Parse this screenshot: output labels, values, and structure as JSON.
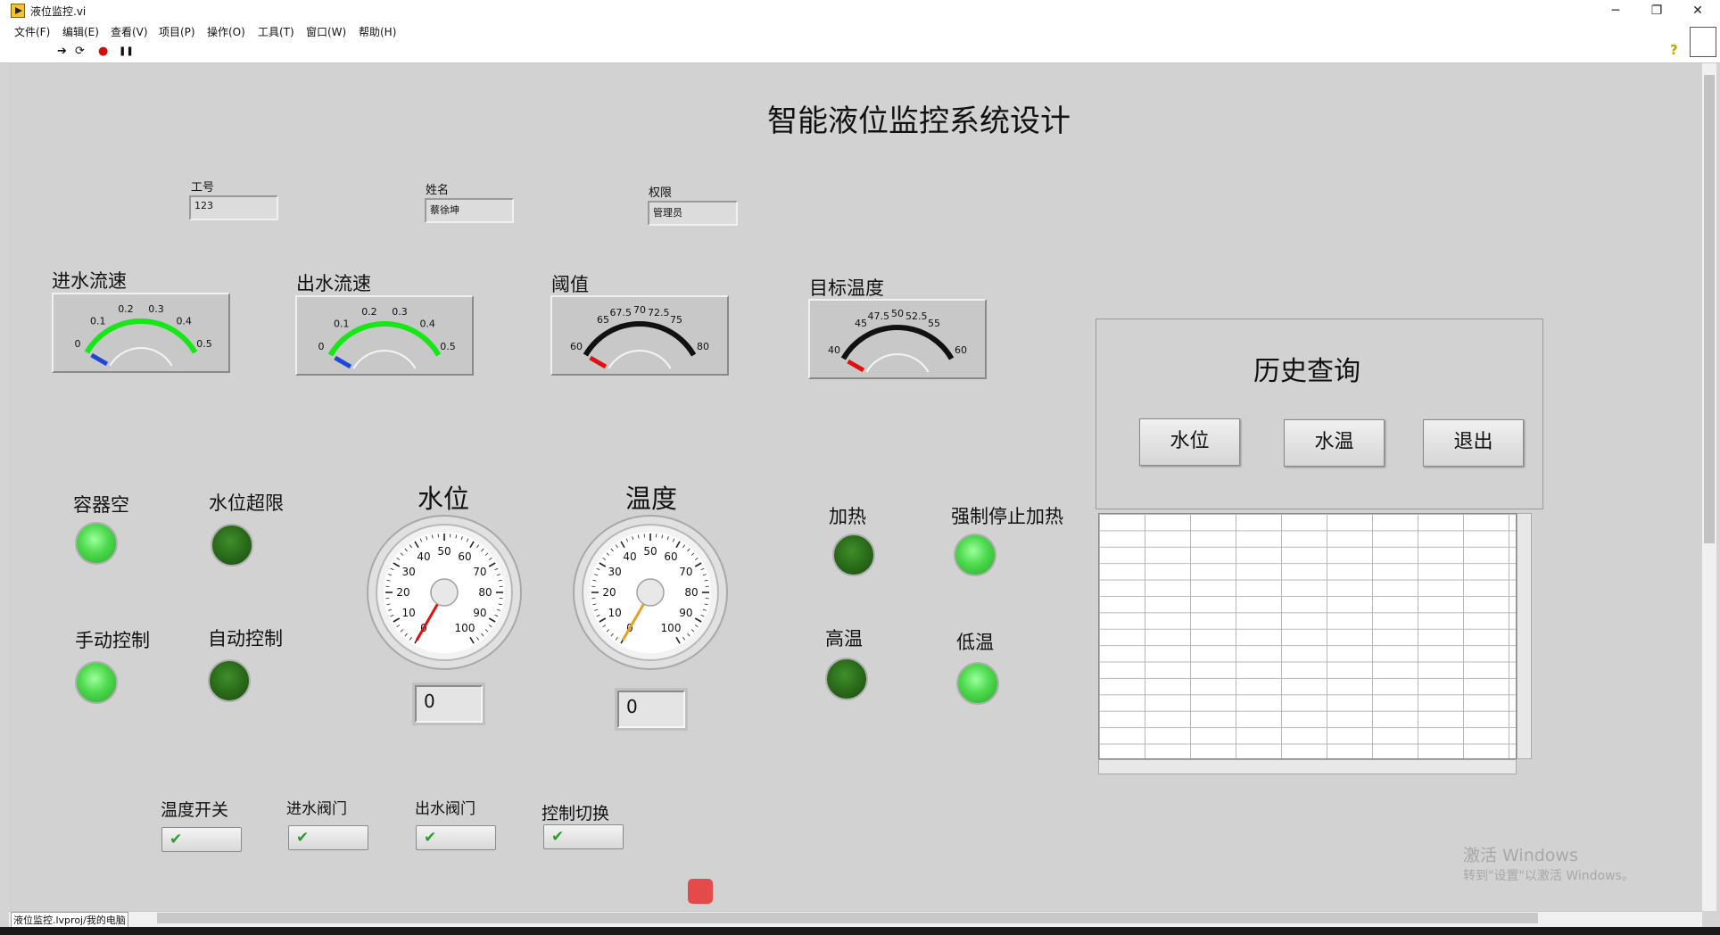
{
  "window": {
    "title": "液位监控.vi",
    "minimize": "─",
    "restore": "❐",
    "close": "✕"
  },
  "menu": [
    "文件(F)",
    "编辑(E)",
    "查看(V)",
    "项目(P)",
    "操作(O)",
    "工具(T)",
    "窗口(W)",
    "帮助(H)"
  ],
  "toolbar": {
    "run": "➔",
    "run_cont": "⟳",
    "abort": "●",
    "pause": "❚❚",
    "help": "?"
  },
  "panel": {
    "title": "智能液位监控系统设计",
    "fields": [
      {
        "label": "工号",
        "value": "123"
      },
      {
        "label": "姓名",
        "value": "蔡徐坤"
      },
      {
        "label": "权限",
        "value": "管理员"
      }
    ],
    "meters": [
      {
        "label": "进水流速",
        "ticks": [
          "0",
          "0.1",
          "0.2",
          "0.3",
          "0.4",
          "0.5"
        ],
        "value": 0,
        "needle_color": "#1e46d8",
        "arc_color": "#17e617"
      },
      {
        "label": "出水流速",
        "ticks": [
          "0",
          "0.1",
          "0.2",
          "0.3",
          "0.4",
          "0.5"
        ],
        "value": 0,
        "needle_color": "#1e46d8",
        "arc_color": "#17e617"
      },
      {
        "label": "阈值",
        "ticks": [
          "60",
          "65",
          "67.5",
          "70",
          "72.5",
          "75",
          "80"
        ],
        "value": 60,
        "needle_color": "#e01010",
        "arc_color": "#111111"
      },
      {
        "label": "目标温度",
        "ticks": [
          "40",
          "45",
          "47.5",
          "50",
          "52.5",
          "55",
          "60"
        ],
        "value": 40,
        "needle_color": "#e01010",
        "arc_color": "#111111"
      }
    ],
    "leds": [
      {
        "label": "容器空",
        "state": "on"
      },
      {
        "label": "水位超限",
        "state": "off"
      },
      {
        "label": "手动控制",
        "state": "on"
      },
      {
        "label": "自动控制",
        "state": "off"
      },
      {
        "label": "加热",
        "state": "off"
      },
      {
        "label": "强制停止加热",
        "state": "on"
      },
      {
        "label": "高温",
        "state": "off"
      },
      {
        "label": "低温",
        "state": "on"
      }
    ],
    "gauges": [
      {
        "label": "水位",
        "ticks": [
          "0",
          "10",
          "20",
          "30",
          "40",
          "50",
          "60",
          "70",
          "80",
          "90",
          "100"
        ],
        "value": 0,
        "needle_color": "#e01010",
        "readout": "0"
      },
      {
        "label": "温度",
        "ticks": [
          "0",
          "10",
          "20",
          "30",
          "40",
          "50",
          "60",
          "70",
          "80",
          "90",
          "100"
        ],
        "value": 0,
        "needle_color": "#e8a020",
        "readout": "0"
      }
    ],
    "switches": [
      {
        "label": "温度开关",
        "mark": "✔"
      },
      {
        "label": "进水阀门",
        "mark": "✔"
      },
      {
        "label": "出水阀门",
        "mark": "✔"
      },
      {
        "label": "控制切换",
        "mark": "✔"
      }
    ],
    "history": {
      "title": "历史查询",
      "buttons": [
        "水位",
        "水温",
        "退出"
      ]
    }
  },
  "status": {
    "path": "液位监控.lvproj/我的电脑"
  },
  "watermark": {
    "line1": "激活 Windows",
    "line2": "转到\"设置\"以激活 Windows。"
  }
}
